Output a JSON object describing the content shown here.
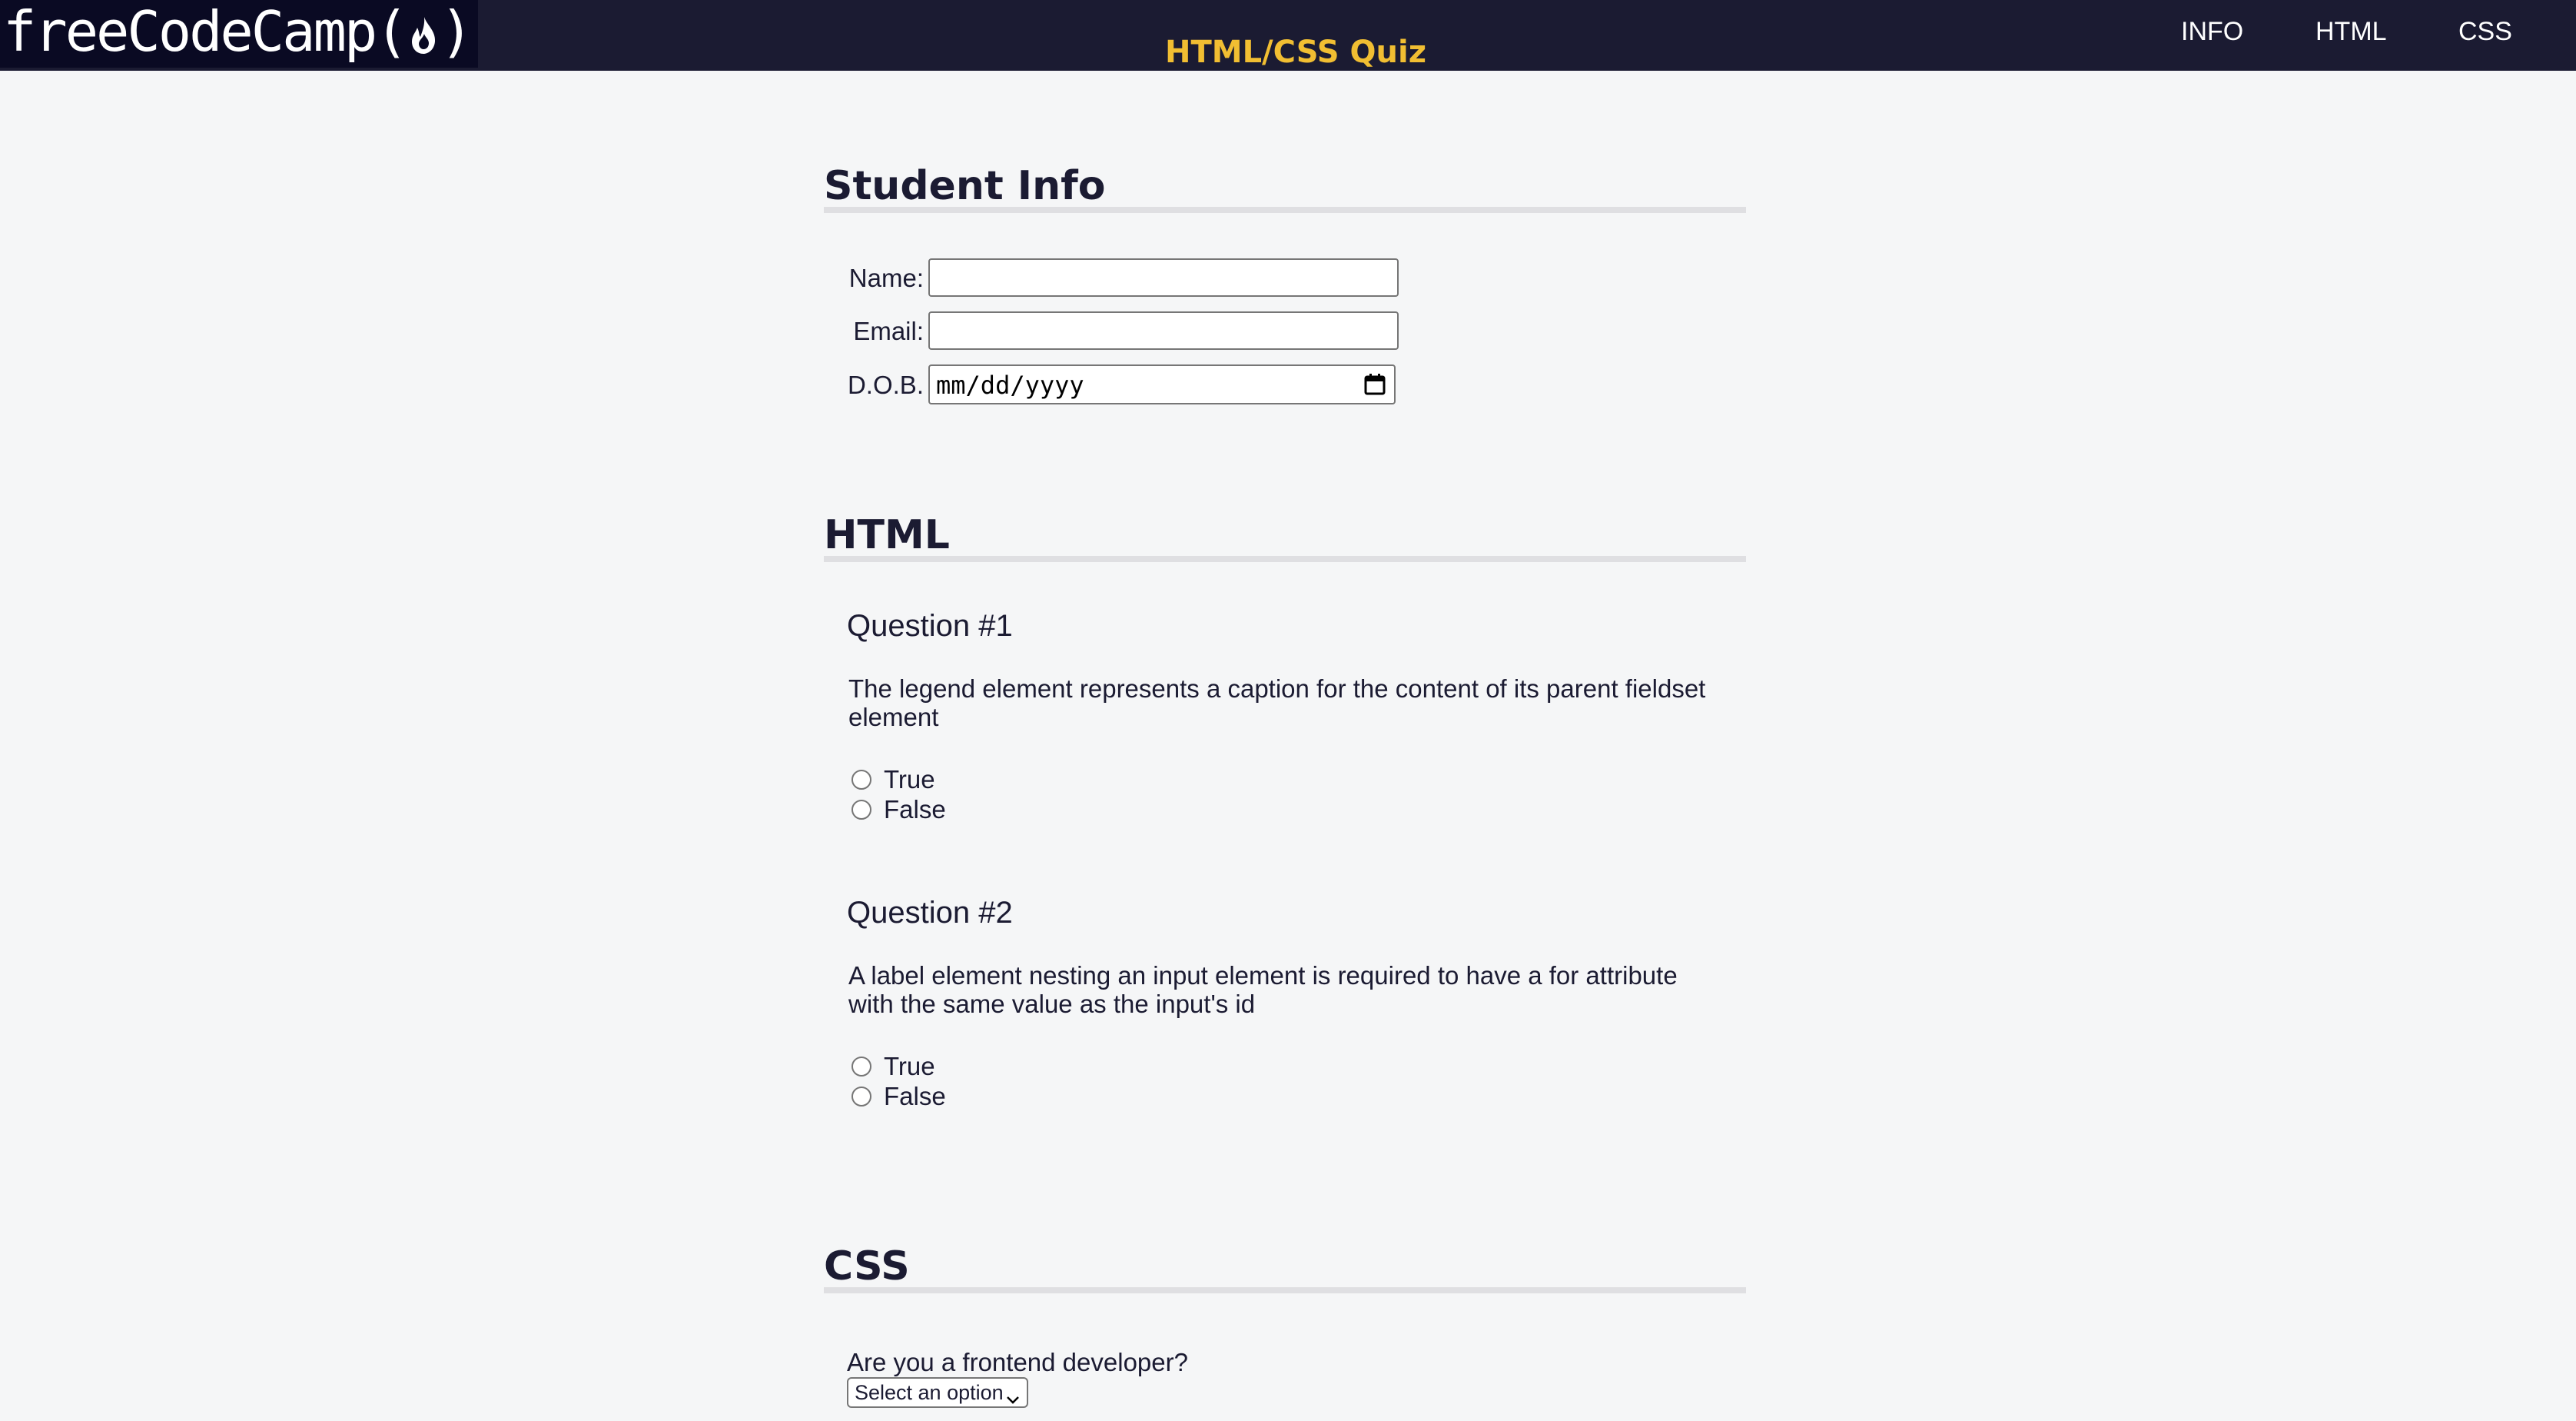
{
  "header": {
    "logo_text": "freeCodeCamp",
    "logo_open": "(",
    "logo_close": ")",
    "title": "HTML/CSS Quiz",
    "nav": [
      "INFO",
      "HTML",
      "CSS"
    ]
  },
  "student_info": {
    "title": "Student Info",
    "name_label": "Name:",
    "name_value": "",
    "email_label": "Email:",
    "email_value": "",
    "dob_label": "D.O.B.",
    "dob_placeholder": "mm/dd/yyyy"
  },
  "html_section": {
    "title": "HTML",
    "questions": [
      {
        "heading": "Question #1",
        "text": "The legend element represents a caption for the content of its parent fieldset element",
        "options": [
          "True",
          "False"
        ]
      },
      {
        "heading": "Question #2",
        "text": "A label element nesting an input element is required to have a for attribute with the same value as the input's id",
        "options": [
          "True",
          "False"
        ]
      }
    ]
  },
  "css_section": {
    "title": "CSS",
    "question": "Are you a frontend developer?",
    "select_value": "Select an option"
  },
  "colors": {
    "nav_bg": "#1b1b32",
    "logo_bg": "#0a0a23",
    "title_accent": "#f1be32",
    "page_bg": "#f5f6f7",
    "rule": "#dfdfe2"
  },
  "icons": [
    "flame-icon",
    "calendar-icon",
    "chevron-down-icon"
  ]
}
